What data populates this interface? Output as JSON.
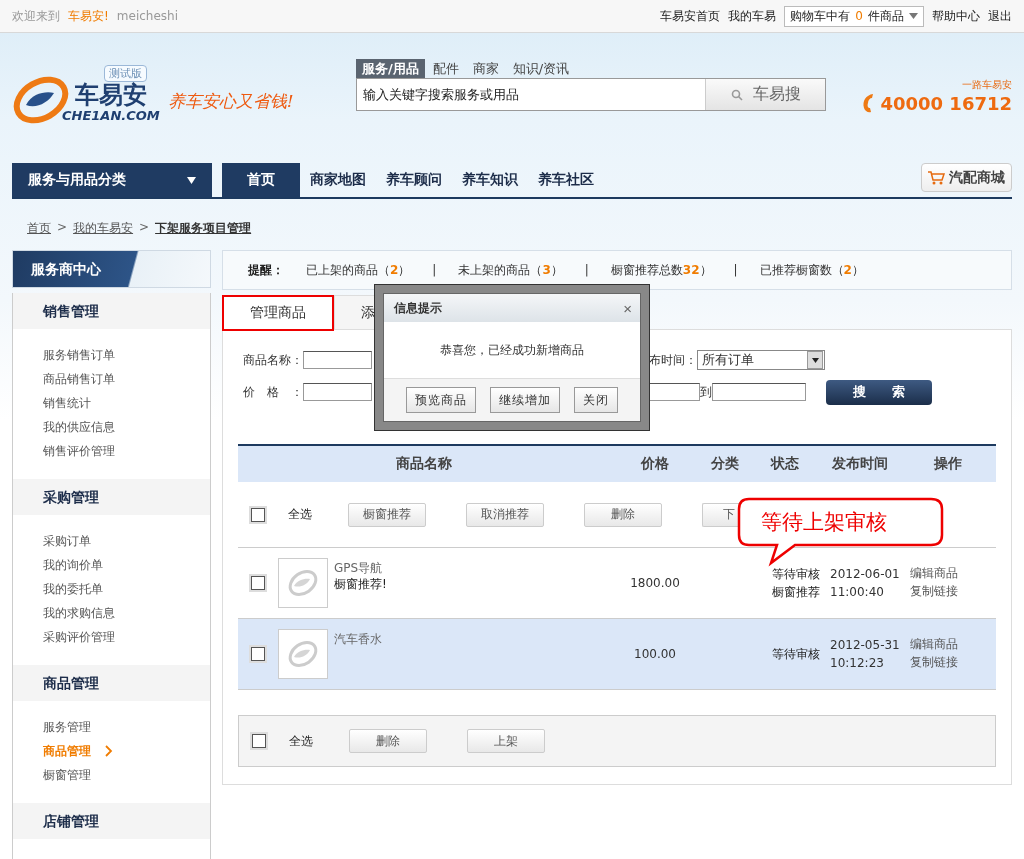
{
  "top_bar": {
    "welcome": "欢迎来到",
    "site": "车易安!",
    "username": "meicheshi",
    "links": [
      "车易安首页",
      "我的车易"
    ],
    "cart": {
      "prefix": "购物车中有",
      "count": "0",
      "suffix": "件商品"
    },
    "links_right": [
      "帮助中心",
      "退出"
    ]
  },
  "header": {
    "logo": {
      "badge": "测试版",
      "name": "车易安",
      "domain": "CHE1AN.COM"
    },
    "slogan": "养车安心又省钱!",
    "search_tabs": [
      {
        "label": "服务/用品",
        "selected": true
      },
      {
        "label": "配件",
        "selected": false
      },
      {
        "label": "商家",
        "selected": false
      },
      {
        "label": "知识/资讯",
        "selected": false
      }
    ],
    "search": {
      "value": "输入关键字搜索服务或用品",
      "button": "车易搜"
    },
    "hotline": {
      "caption": "一路车易安",
      "number": "40000 16712"
    }
  },
  "nav": {
    "category": "服务与用品分类",
    "items": [
      {
        "label": "首页",
        "selected": true
      },
      {
        "label": "商家地图",
        "selected": false
      },
      {
        "label": "养车顾问",
        "selected": false
      },
      {
        "label": "养车知识",
        "selected": false
      },
      {
        "label": "养车社区",
        "selected": false
      }
    ],
    "mall": "汽配商城"
  },
  "breadcrumb": {
    "separator": ">",
    "items": [
      "首页",
      "我的车易安",
      "下架服务项目管理"
    ]
  },
  "sidebar": {
    "title": "服务商中心",
    "groups": [
      {
        "title": "销售管理",
        "items": [
          {
            "label": "服务销售订单",
            "selected": false
          },
          {
            "label": "商品销售订单",
            "selected": false
          },
          {
            "label": "销售统计",
            "selected": false
          },
          {
            "label": "我的供应信息",
            "selected": false
          },
          {
            "label": "销售评价管理",
            "selected": false
          }
        ]
      },
      {
        "title": "采购管理",
        "items": [
          {
            "label": "采购订单",
            "selected": false
          },
          {
            "label": "我的询价单",
            "selected": false
          },
          {
            "label": "我的委托单",
            "selected": false
          },
          {
            "label": "我的求购信息",
            "selected": false
          },
          {
            "label": "采购评价管理",
            "selected": false
          }
        ]
      },
      {
        "title": "商品管理",
        "items": [
          {
            "label": "服务管理",
            "selected": false
          },
          {
            "label": "商品管理",
            "selected": true
          },
          {
            "label": "橱窗管理",
            "selected": false
          }
        ]
      },
      {
        "title": "店铺管理"
      }
    ]
  },
  "reminder": {
    "label": "提醒：",
    "divider": "|",
    "stats": [
      {
        "label": "已上架的商品（",
        "count": "2",
        "end": "）"
      },
      {
        "label": "未上架的商品（",
        "count": "3",
        "end": "）"
      },
      {
        "label": "橱窗推荐总数",
        "count": "32",
        "end": "）"
      },
      {
        "label": "已推荐橱窗数（",
        "count": "2",
        "end": "）"
      }
    ]
  },
  "tabs": [
    {
      "label": "管理商品",
      "selected": true
    },
    {
      "label": "添",
      "selected": false
    }
  ],
  "filters": {
    "name_label": "商品名称：",
    "time_label": "布时间：",
    "time_select": "所有订单",
    "price_label": "价　格　：",
    "to_label": "到",
    "search_button": "搜　　索"
  },
  "table": {
    "columns": [
      "商品名称",
      "价格",
      "分类",
      "状态",
      "发布时间",
      "操作"
    ],
    "toolbar": {
      "select_all": "全选",
      "checked": false,
      "buttons": [
        "橱窗推荐",
        "取消推荐",
        "删除",
        "下"
      ]
    },
    "rows": [
      {
        "checked": false,
        "highlighted": false,
        "name": "GPS导航",
        "tag": "橱窗推荐!",
        "price": "1800.00",
        "status": "等待审核",
        "status_tag": "橱窗推荐",
        "date": "2012-06-01",
        "time": "11:00:40",
        "actions": [
          "编辑商品",
          "复制链接"
        ]
      },
      {
        "checked": false,
        "highlighted": true,
        "name": "汽车香水",
        "price": "100.00",
        "status": "等待审核",
        "date": "2012-05-31",
        "time": "10:12:23",
        "actions": [
          "编辑商品",
          "复制链接"
        ]
      }
    ]
  },
  "footer_bar": {
    "select_all": "全选",
    "checked": false,
    "buttons": [
      "删除",
      "上架"
    ]
  },
  "dialog": {
    "title": "信息提示",
    "close": "×",
    "message": "恭喜您，已经成功新增商品",
    "buttons": [
      "预览商品",
      "继续增加",
      "关闭"
    ]
  },
  "callout": {
    "text": "等待上架审核"
  }
}
